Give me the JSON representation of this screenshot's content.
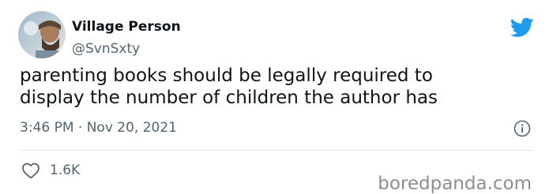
{
  "tweet": {
    "author_name": "Village Person",
    "author_handle": "@SvnSxty",
    "text_lines": [
      "parenting books should be legally required to",
      "display the number of children the author has"
    ],
    "timestamp": "3:46 PM · Nov 20, 2021",
    "like_count": "1.6K"
  },
  "watermark": "boredpanda.com",
  "colors": {
    "twitter_blue": "#1d9bf0",
    "secondary_text": "#536471",
    "primary_text": "#0f1419",
    "divider": "#e1e8ed"
  },
  "icons": {
    "brand": "twitter-bird-icon",
    "info": "info-icon",
    "like": "heart-icon"
  }
}
